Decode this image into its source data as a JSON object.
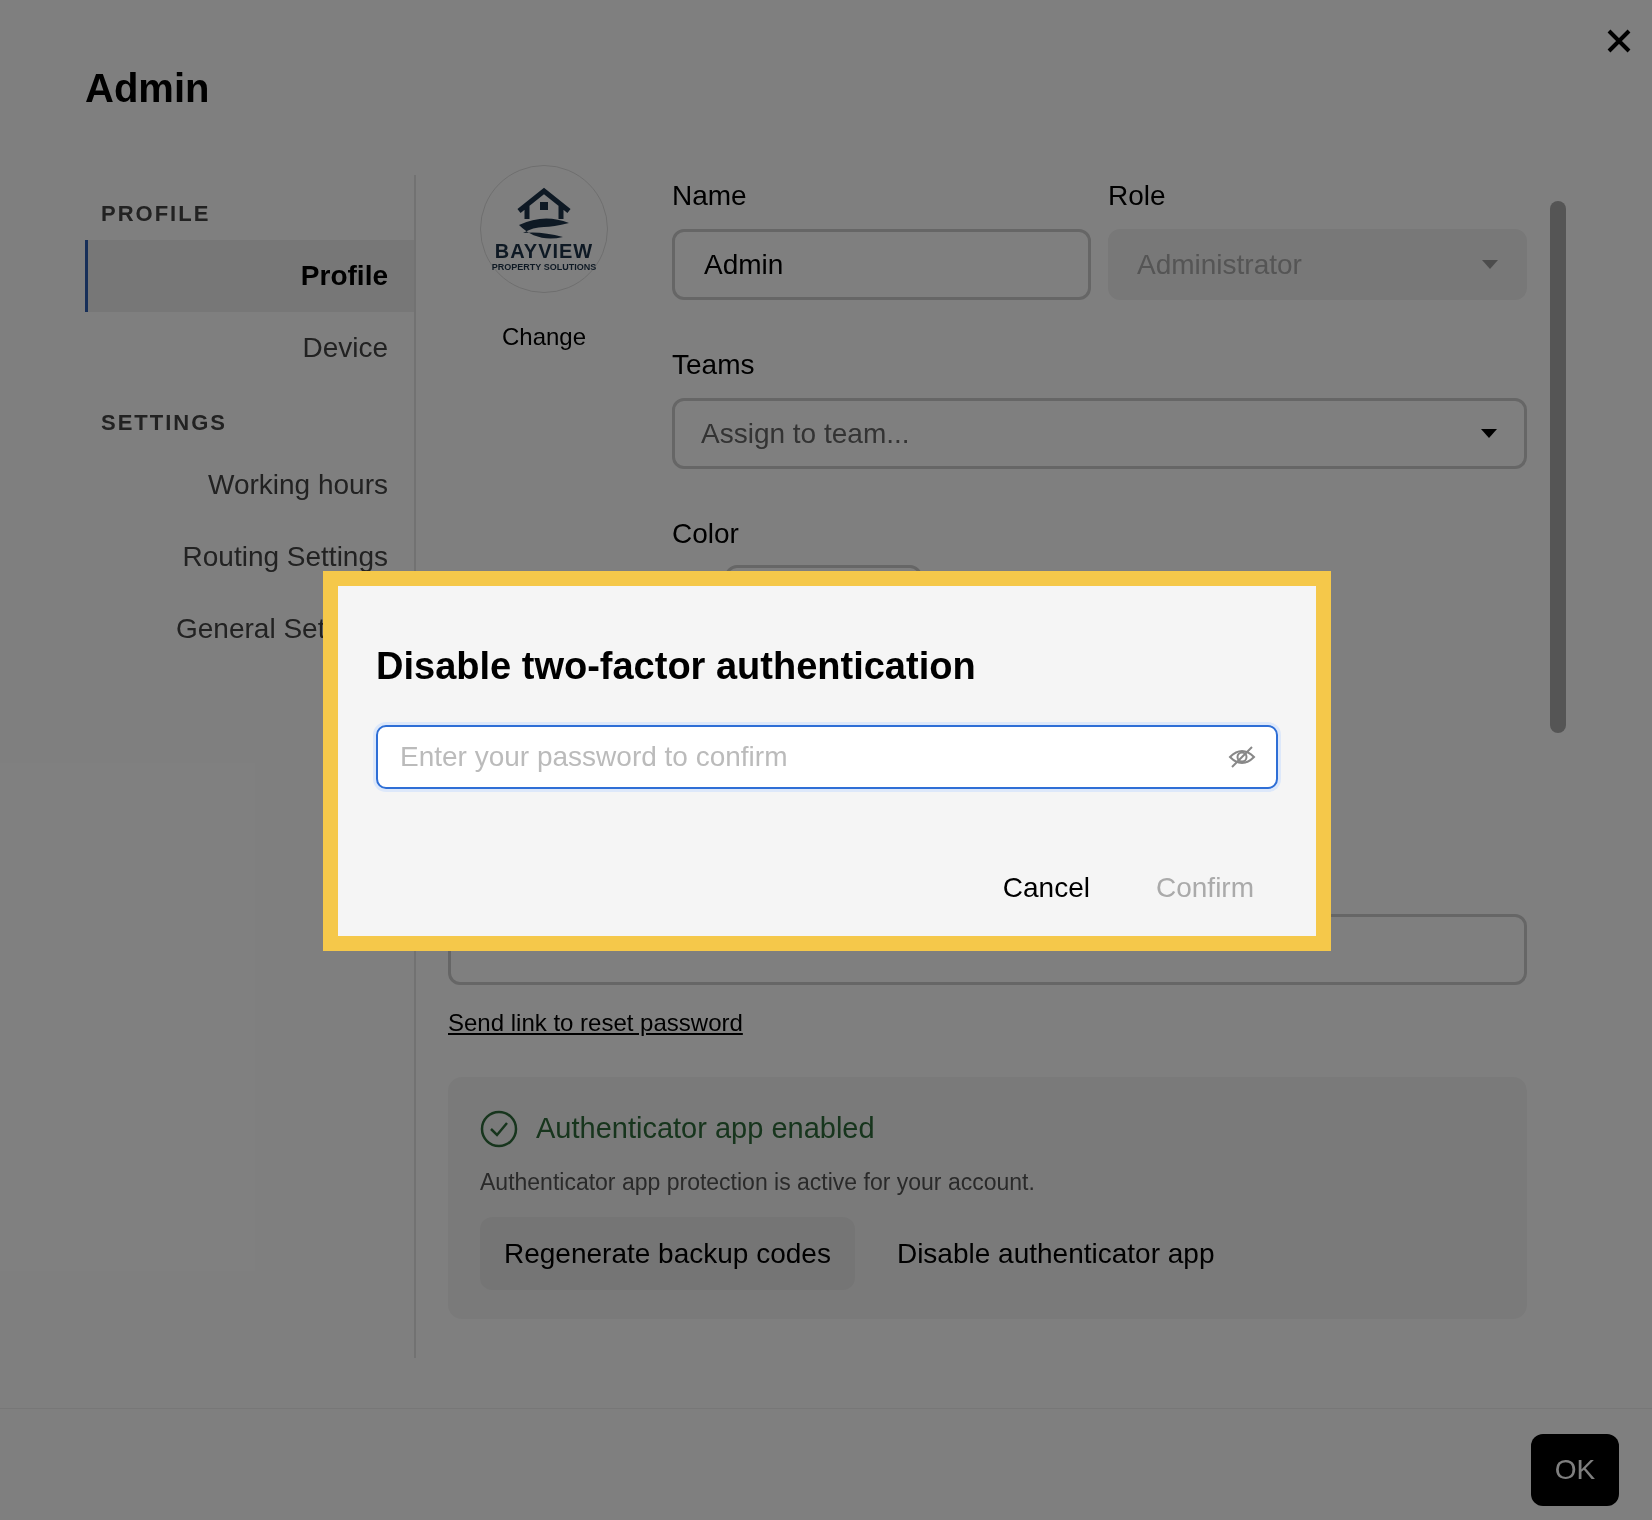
{
  "window": {
    "title": "Admin"
  },
  "sidebar": [
    {
      "heading": "PROFILE",
      "items": [
        {
          "label": "Profile",
          "selected": true
        },
        {
          "label": "Device",
          "selected": false
        }
      ]
    },
    {
      "heading": "SETTINGS",
      "items": [
        {
          "label": "Working hours",
          "selected": false
        },
        {
          "label": "Routing Settings",
          "selected": false
        },
        {
          "label": "General Set",
          "selected": false,
          "kind": "cut-off"
        }
      ]
    }
  ],
  "avatar": {
    "logo_text": "BAYVIEW",
    "logo_subtext": "PROPERTY SOLUTIONS",
    "action": "Change"
  },
  "fields": {
    "name": {
      "label": "Name",
      "value": "Admin"
    },
    "role": {
      "label": "Role",
      "value": "Administrator",
      "disabled": true
    },
    "teams": {
      "label": "Teams",
      "placeholder": "Assign to team..."
    },
    "color": {
      "label": "Color"
    }
  },
  "reset_link": "Send link to reset password",
  "authenticator": {
    "status": "Authenticator app enabled",
    "description": "Authenticator app protection is active for your account.",
    "buttons": [
      "Regenerate backup codes",
      "Disable authenticator app"
    ]
  },
  "dialog": {
    "title": "Disable two-factor authentication",
    "password": {
      "placeholder": "Enter your password to confirm"
    },
    "cancel": "Cancel",
    "confirm": {
      "label": "Confirm",
      "disabled": true
    }
  },
  "footer": {
    "ok": "OK"
  }
}
